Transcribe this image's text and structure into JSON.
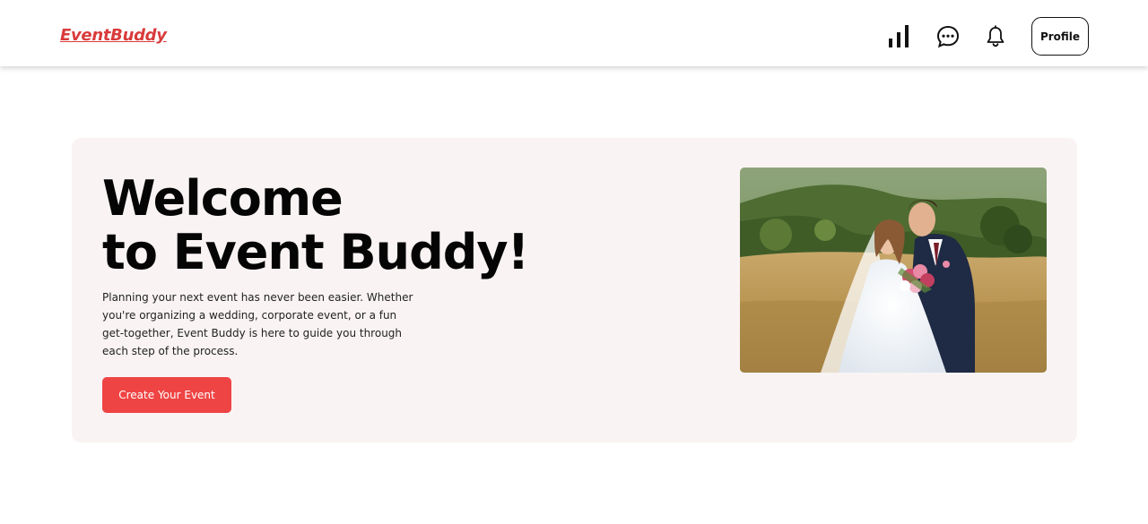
{
  "navbar": {
    "brand": "EventBuddy",
    "icons": {
      "stats": "bar-chart-icon",
      "chat": "chat-bubble-icon",
      "bell": "bell-icon"
    },
    "profile_label": "Profile"
  },
  "hero": {
    "title_line1": "Welcome",
    "title_line2": "to Event Buddy!",
    "description": "Planning your next event has never been easier. Whether you're organizing a wedding, corporate event, or a fun get-together, Event Buddy is here to guide you through each step of the process.",
    "cta_label": "Create Your Event",
    "image_subject": "wedding-couple-photo"
  },
  "colors": {
    "brand": "#d93b3b",
    "cta": "#ef4444",
    "hero_bg": "#f9f4f3",
    "text": "#050505"
  }
}
